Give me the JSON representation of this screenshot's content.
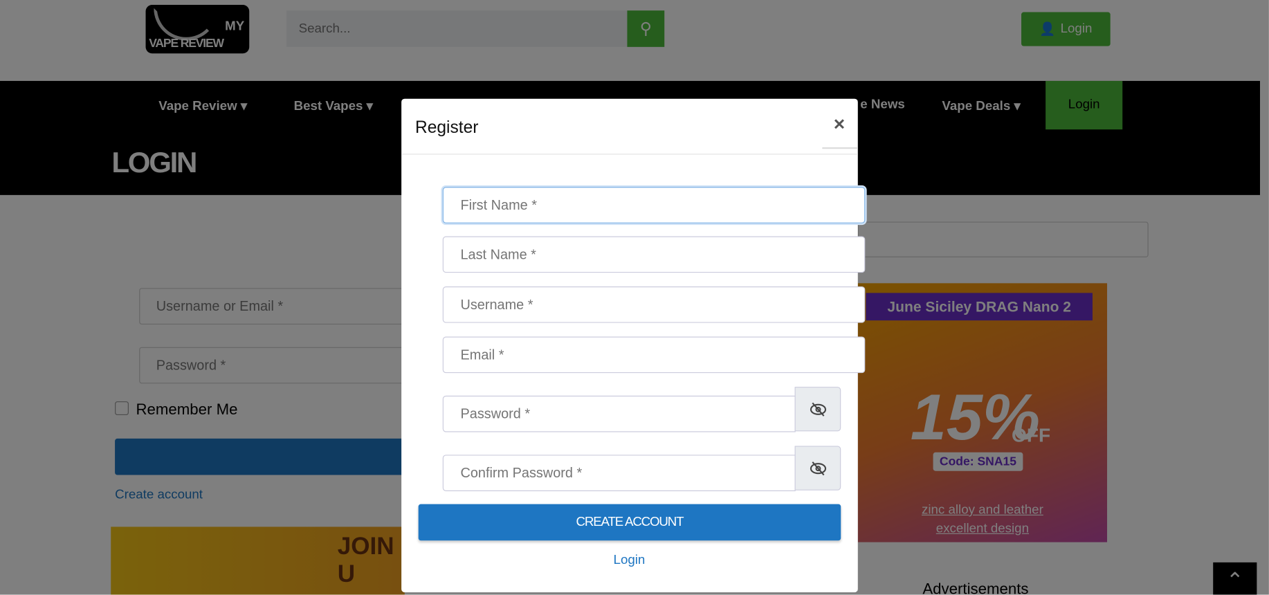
{
  "header": {
    "logo_top": "MY",
    "logo_bottom": "VAPE REVIEW",
    "search_placeholder": "Search...",
    "login_label": "Login"
  },
  "nav": {
    "items": [
      {
        "label": "Vape Review"
      },
      {
        "label": "Best Vapes"
      },
      {
        "label": "e News"
      },
      {
        "label": "Vape Deals"
      }
    ],
    "login_label": "Login"
  },
  "page": {
    "title": "LOGIN",
    "username_placeholder": "Username or Email *",
    "password_placeholder": "Password *",
    "remember_label": "Remember Me",
    "create_account_link": "Create account",
    "advertisements_label": "Advertisements"
  },
  "ad": {
    "headline": "June Siciley DRAG Nano 2",
    "discount": "15%",
    "off": "OFF",
    "code": "Code: SNA15",
    "line1": "zinc alloy and leather",
    "line2": "excellent design",
    "join": "JOIN U"
  },
  "modal": {
    "title": "Register",
    "close": "×",
    "fields": [
      {
        "placeholder": "First Name *"
      },
      {
        "placeholder": "Last Name *"
      },
      {
        "placeholder": "Username *"
      },
      {
        "placeholder": "Email *"
      },
      {
        "placeholder": "Password *"
      },
      {
        "placeholder": "Confirm Password *"
      }
    ],
    "submit_label": "CREATE ACCOUNT",
    "login_link": "Login"
  },
  "colors": {
    "green": "#4cbb3a",
    "blue": "#1e76c2",
    "nav_bg": "#000000"
  }
}
